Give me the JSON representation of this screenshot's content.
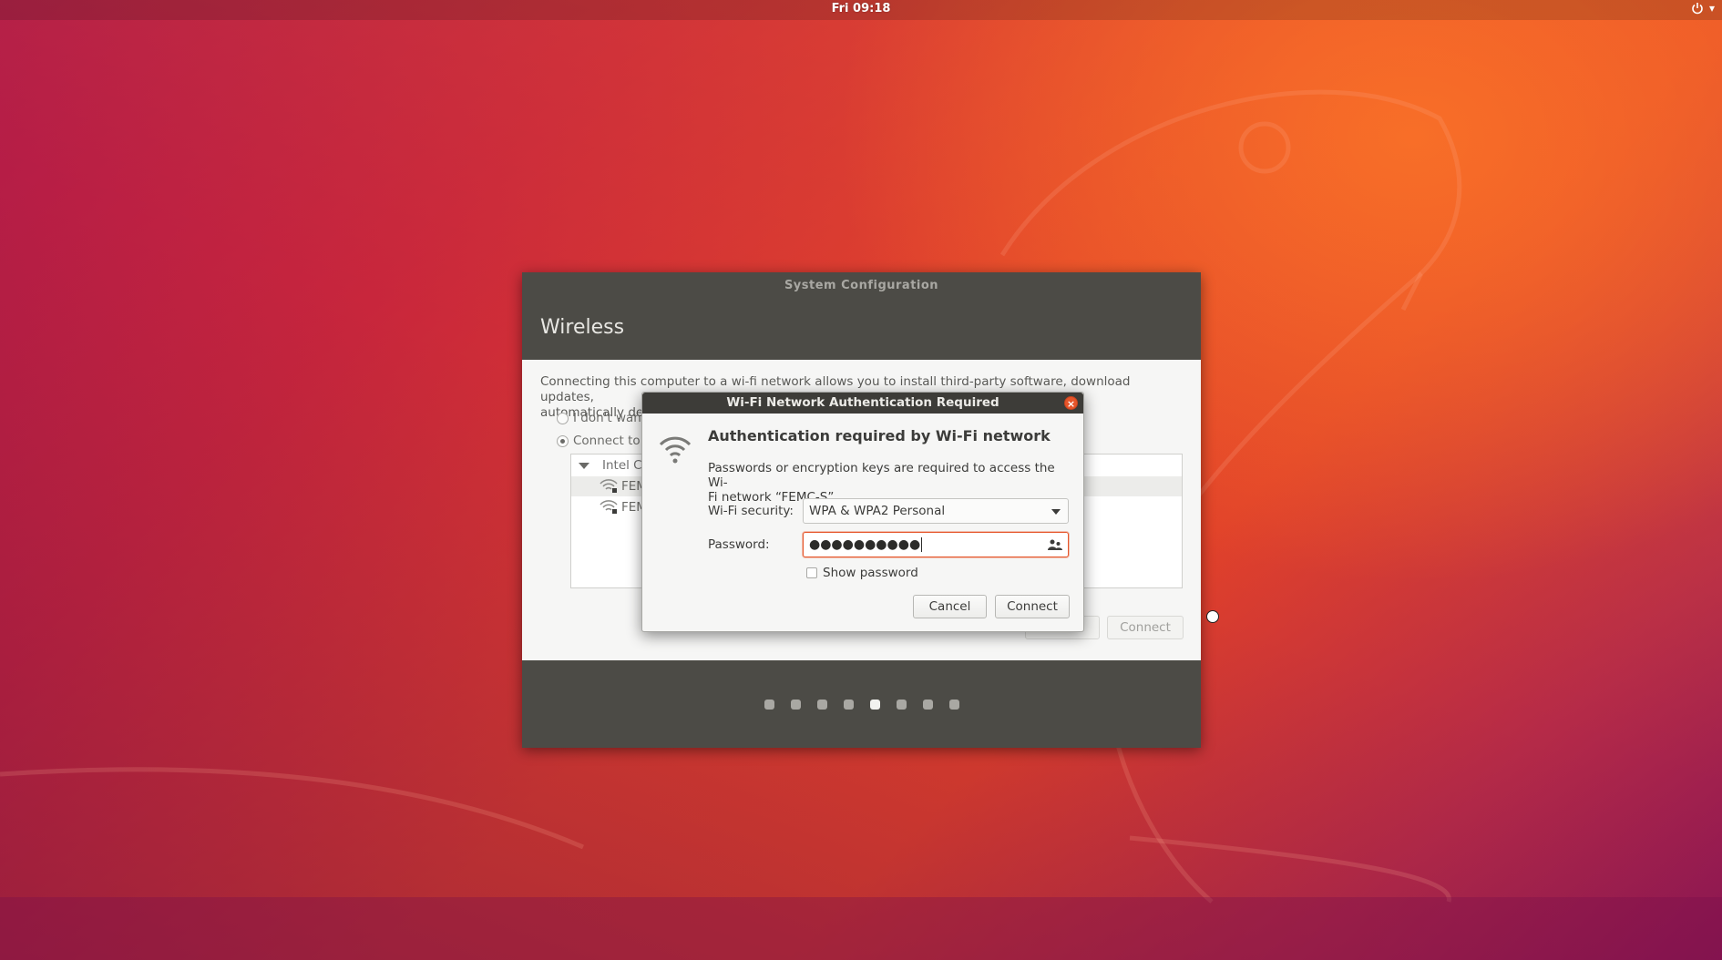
{
  "topbar": {
    "clock": "Fri 09:18"
  },
  "main_window": {
    "title": "System Configuration",
    "heading": "Wireless",
    "intro_line1": "Connecting this computer to a wi-fi network allows you to install third-party software, download updates,",
    "intro_line2": "automatically de",
    "radio_dont": "I don't want",
    "radio_connect": "Connect to t",
    "adapter": "Intel C",
    "networks": [
      "FEM",
      "FEM"
    ],
    "back_button": "Back",
    "connect_button": "Connect",
    "progress_dots": {
      "total": 8,
      "active_index": 4
    }
  },
  "auth_dialog": {
    "title": "Wi-Fi Network Authentication Required",
    "heading": "Authentication required by Wi-Fi network",
    "description_line1": "Passwords or encryption keys are required to access the Wi-",
    "description_line2": "Fi network “FEMC-S”.",
    "security_label": "Wi-Fi security:",
    "security_value": "WPA & WPA2 Personal",
    "password_label": "Password:",
    "password_value": "●●●●●●●●●●",
    "show_password_label": "Show password",
    "cancel_button": "Cancel",
    "connect_button": "Connect",
    "close_glyph": "×"
  },
  "colors": {
    "accent": "#e6552a",
    "titlebar": "#4c4b46",
    "dialog_bg": "#f6f6f5"
  }
}
